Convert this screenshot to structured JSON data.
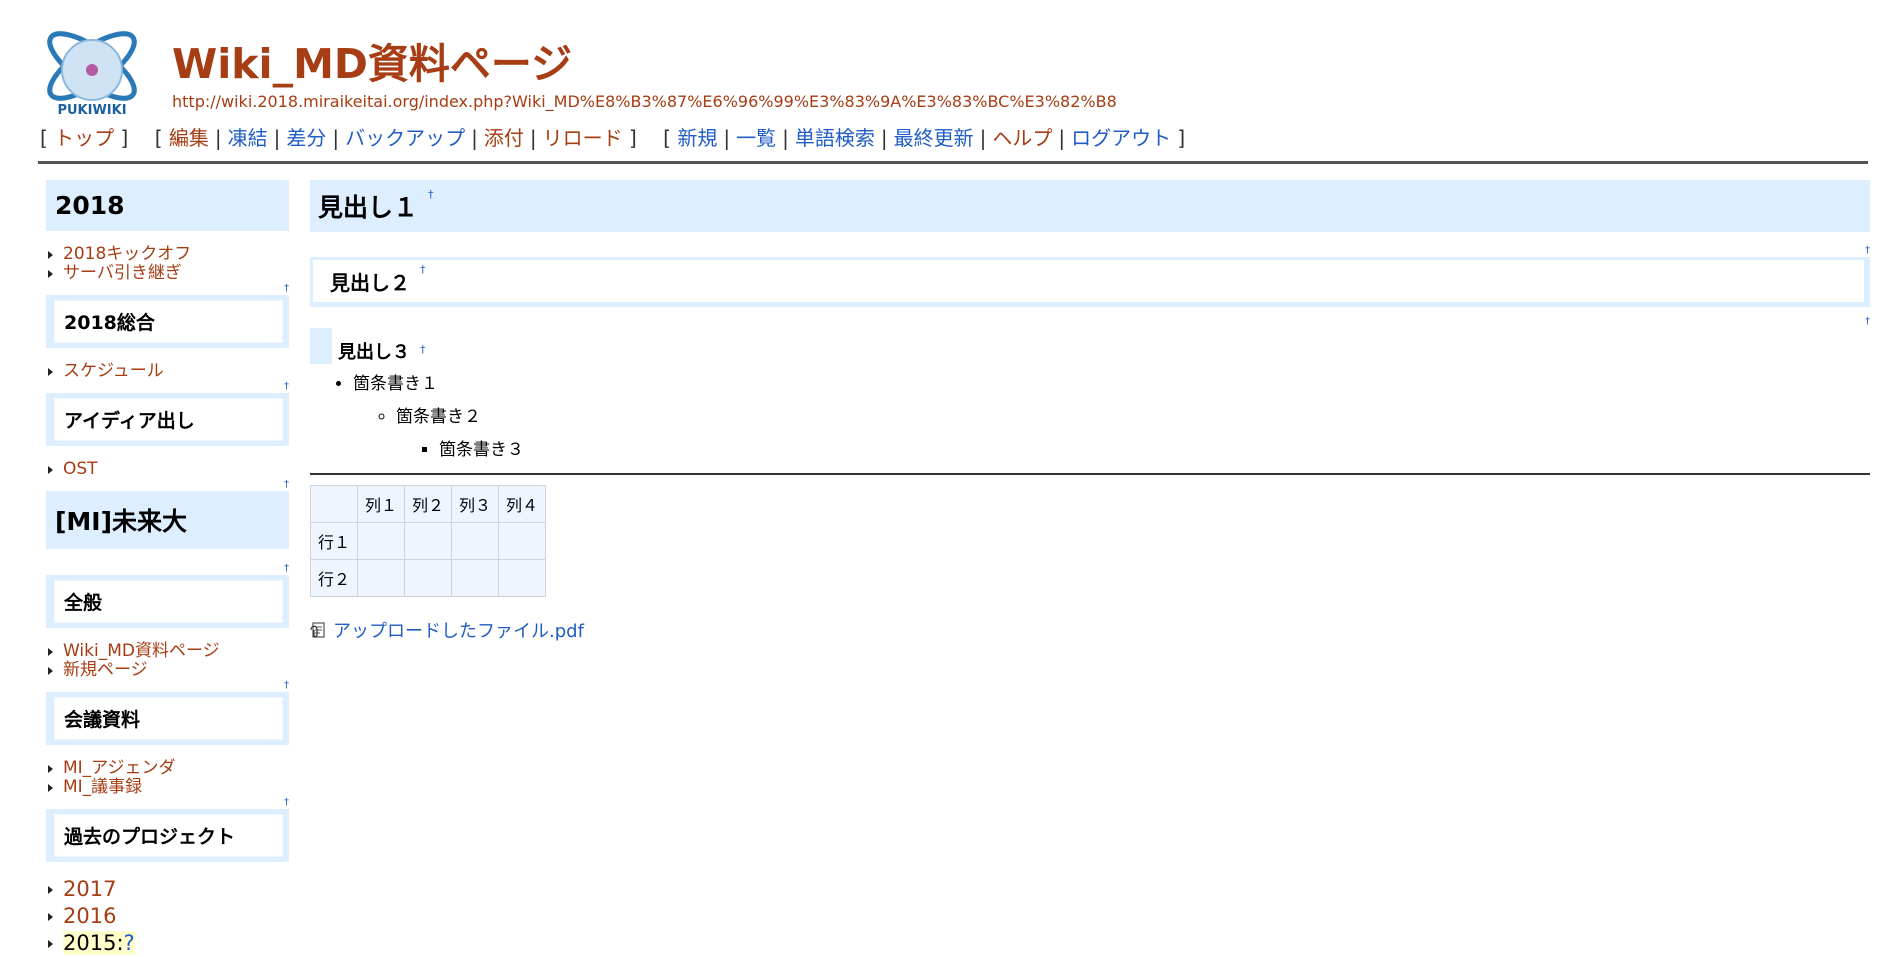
{
  "page": {
    "title": "Wiki_MD資料ページ",
    "url": "http://wiki.2018.miraikeitai.org/index.php?Wiki_MD%E8%B3%87%E6%96%99%E3%83%9A%E3%83%BC%E3%82%B8",
    "logo_text": "PUKIWIKI"
  },
  "nav": {
    "top": "トップ",
    "edit": "編集",
    "freeze": "凍結",
    "diff": "差分",
    "backup": "バックアップ",
    "attach": "添付",
    "reload": "リロード",
    "new": "新規",
    "list": "一覧",
    "search": "単語検索",
    "recent": "最終更新",
    "help": "ヘルプ",
    "logout": "ログアウト"
  },
  "sidebar": {
    "h2_2018": "2018",
    "items_2018": [
      "2018キックオフ",
      "サーバ引き継ぎ"
    ],
    "h3_general": "2018総合",
    "items_general": [
      "スケジュール"
    ],
    "h3_idea": "アイディア出し",
    "items_idea": [
      "OST"
    ],
    "h2_mi": "[MI]未来大",
    "h3_all": "全般",
    "items_all": [
      "Wiki_MD資料ページ",
      "新規ページ"
    ],
    "h3_meeting": "会議資料",
    "items_meeting": [
      "MI_アジェンダ",
      "MI_議事録"
    ],
    "h3_past": "過去のプロジェクト",
    "items_past": [
      "2017",
      "2016"
    ],
    "item_2015": "2015",
    "item_2015_q": "?",
    "jump": "†"
  },
  "content": {
    "h1": "見出し１",
    "h2": "見出し２",
    "h3": "見出し３",
    "anchor": "†",
    "bullet1": "箇条書き１",
    "bullet2": "箇条書き２",
    "bullet3": "箇条書き３",
    "table": {
      "headers": [
        "",
        "列１",
        "列２",
        "列３",
        "列４"
      ],
      "rows": [
        [
          "行１",
          "",
          "",
          "",
          ""
        ],
        [
          "行２",
          "",
          "",
          "",
          ""
        ]
      ]
    },
    "attachment": "アップロードしたファイル.pdf"
  },
  "colors": {
    "link_brown": "#a63d14",
    "link_blue": "#215dc6",
    "heading_bg": "#ddeeff"
  }
}
